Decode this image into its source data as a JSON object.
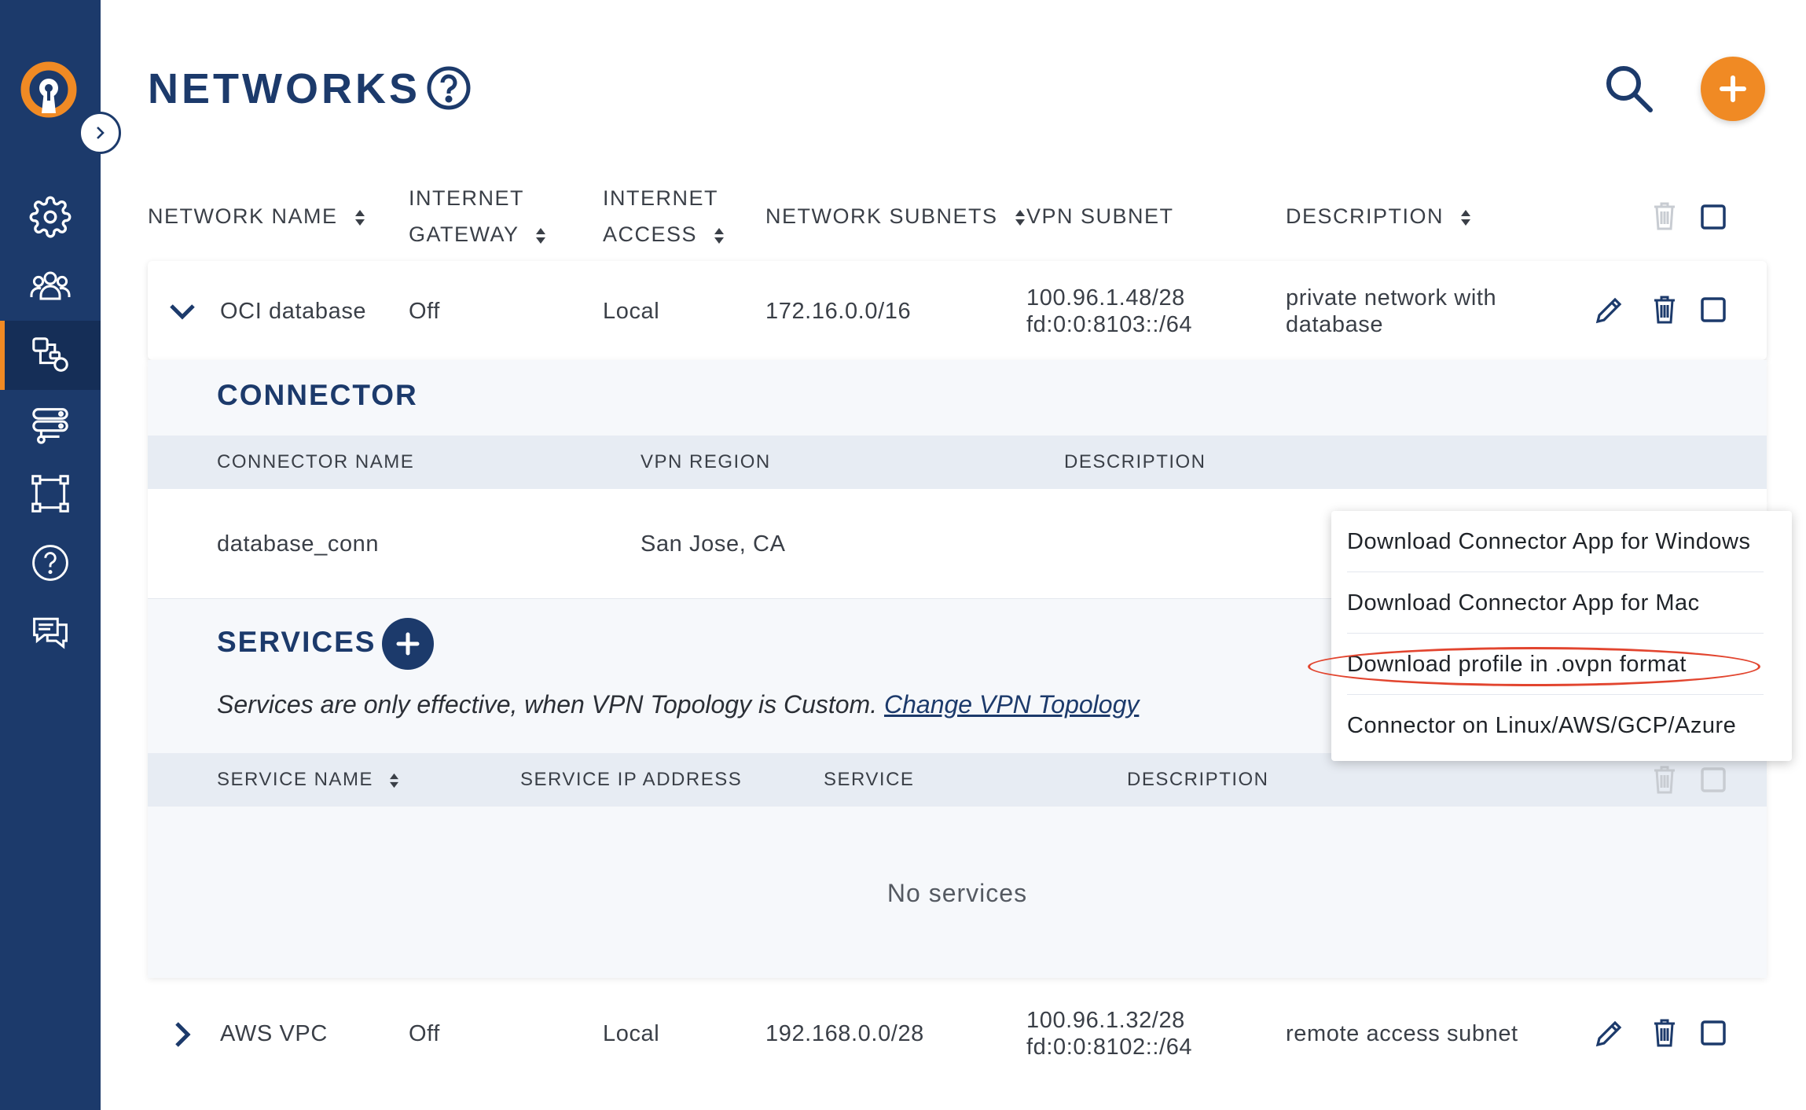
{
  "page": {
    "title": "NETWORKS"
  },
  "table": {
    "headers": {
      "network_name": "NETWORK NAME",
      "internet_gateway_1": "INTERNET",
      "internet_gateway_2": "GATEWAY",
      "internet_access_1": "INTERNET",
      "internet_access_2": "ACCESS",
      "network_subnets": "NETWORK SUBNETS",
      "vpn_subnet": "VPN SUBNET",
      "description": "DESCRIPTION"
    },
    "rows": [
      {
        "name": "OCI database",
        "gateway": "Off",
        "access": "Local",
        "subnets": "172.16.0.0/16",
        "vpn_subnet_1": "100.96.1.48/28",
        "vpn_subnet_2": "fd:0:0:8103::/64",
        "description_1": "private network with",
        "description_2": "database"
      },
      {
        "name": "AWS VPC",
        "gateway": "Off",
        "access": "Local",
        "subnets": "192.168.0.0/28",
        "vpn_subnet_1": "100.96.1.32/28",
        "vpn_subnet_2": "fd:0:0:8102::/64",
        "description": "remote access subnet"
      }
    ]
  },
  "connector": {
    "title": "CONNECTOR",
    "headers": {
      "name": "CONNECTOR NAME",
      "region": "VPN REGION",
      "description": "DESCRIPTION"
    },
    "row": {
      "name": "database_conn",
      "region": "San Jose, CA"
    }
  },
  "services": {
    "title": "SERVICES",
    "note": "Services are only effective, when VPN Topology is Custom.",
    "link": "Change VPN Topology",
    "headers": {
      "name": "SERVICE NAME",
      "ip": "SERVICE IP ADDRESS",
      "service": "SERVICE",
      "description": "DESCRIPTION"
    },
    "empty": "No services"
  },
  "dropdown": {
    "items": [
      "Download Connector App for Windows",
      "Download Connector App for Mac",
      "Download profile in .ovpn format",
      "Connector on Linux/AWS/GCP/Azure"
    ]
  },
  "colors": {
    "sidebar": "#1c3a6b",
    "accent": "#f08a24",
    "highlight": "#e2452f"
  }
}
